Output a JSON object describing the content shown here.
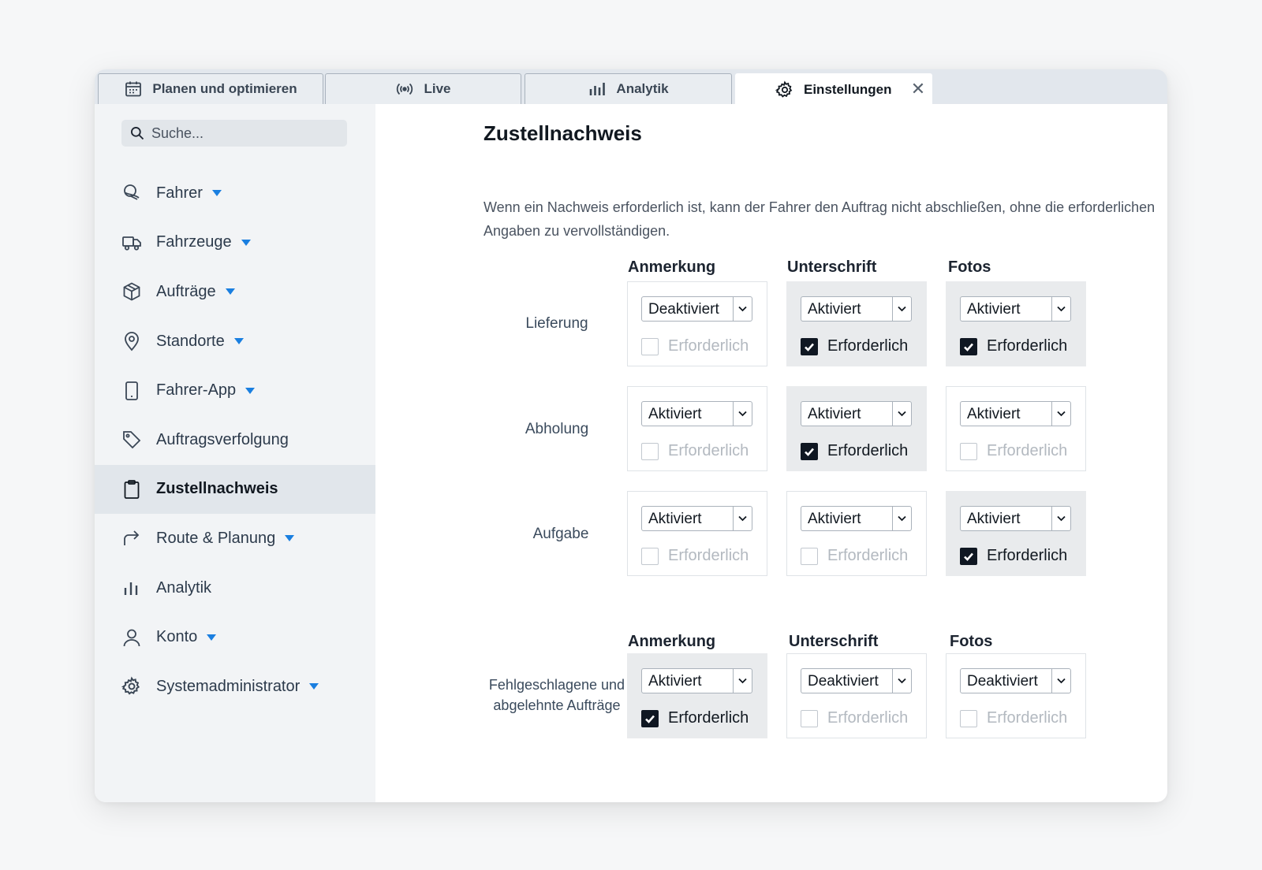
{
  "tabs": [
    {
      "label": "Planen und optimieren",
      "icon": "calendar-icon"
    },
    {
      "label": "Live",
      "icon": "live-signal-icon"
    },
    {
      "label": "Analytik",
      "icon": "bar-chart-icon"
    },
    {
      "label": "Einstellungen",
      "icon": "gear-icon",
      "active": true
    }
  ],
  "tab_close": "✕",
  "search": {
    "placeholder": "Suche..."
  },
  "sidebar": {
    "items": [
      {
        "label": "Fahrer",
        "icon": "driver-icon",
        "caret": true
      },
      {
        "label": "Fahrzeuge",
        "icon": "truck-icon",
        "caret": true
      },
      {
        "label": "Aufträge",
        "icon": "package-icon",
        "caret": true
      },
      {
        "label": "Standorte",
        "icon": "location-pin-icon",
        "caret": true
      },
      {
        "label": "Fahrer-App",
        "icon": "phone-icon",
        "caret": true
      },
      {
        "label": "Auftragsverfolgung",
        "icon": "tag-icon",
        "caret": false
      },
      {
        "label": "Zustellnachweis",
        "icon": "clipboard-icon",
        "caret": false,
        "active": true
      },
      {
        "label": "Route & Planung",
        "icon": "route-arrow-icon",
        "caret": true
      },
      {
        "label": "Analytik",
        "icon": "analytics-icon",
        "caret": false
      },
      {
        "label": "Konto",
        "icon": "user-icon",
        "caret": true
      },
      {
        "label": "Systemadministrator",
        "icon": "gear-icon",
        "caret": true
      }
    ]
  },
  "main": {
    "title": "Zustellnachweis",
    "description": "Wenn ein Nachweis erforderlich ist, kann der Fahrer den Auftrag nicht abschließen, ohne die erforderlichen Angaben zu vervollständigen.",
    "columns": [
      "Anmerkung",
      "Unterschrift",
      "Fotos"
    ],
    "required_label": "Erforderlich",
    "rows": [
      {
        "label": "Lieferung",
        "cells": [
          {
            "value": "Deaktiviert",
            "required": false
          },
          {
            "value": "Aktiviert",
            "required": true
          },
          {
            "value": "Aktiviert",
            "required": true
          }
        ]
      },
      {
        "label": "Abholung",
        "cells": [
          {
            "value": "Aktiviert",
            "required": false
          },
          {
            "value": "Aktiviert",
            "required": true
          },
          {
            "value": "Aktiviert",
            "required": false
          }
        ]
      },
      {
        "label": "Aufgabe",
        "cells": [
          {
            "value": "Aktiviert",
            "required": false
          },
          {
            "value": "Aktiviert",
            "required": false
          },
          {
            "value": "Aktiviert",
            "required": true
          }
        ]
      }
    ],
    "failed_section": {
      "label_line1": "Fehlgeschlagene und",
      "label_line2": "abgelehnte Aufträge",
      "cells": [
        {
          "value": "Aktiviert",
          "required": true
        },
        {
          "value": "Deaktiviert",
          "required": false
        },
        {
          "value": "Deaktiviert",
          "required": false
        }
      ]
    }
  }
}
